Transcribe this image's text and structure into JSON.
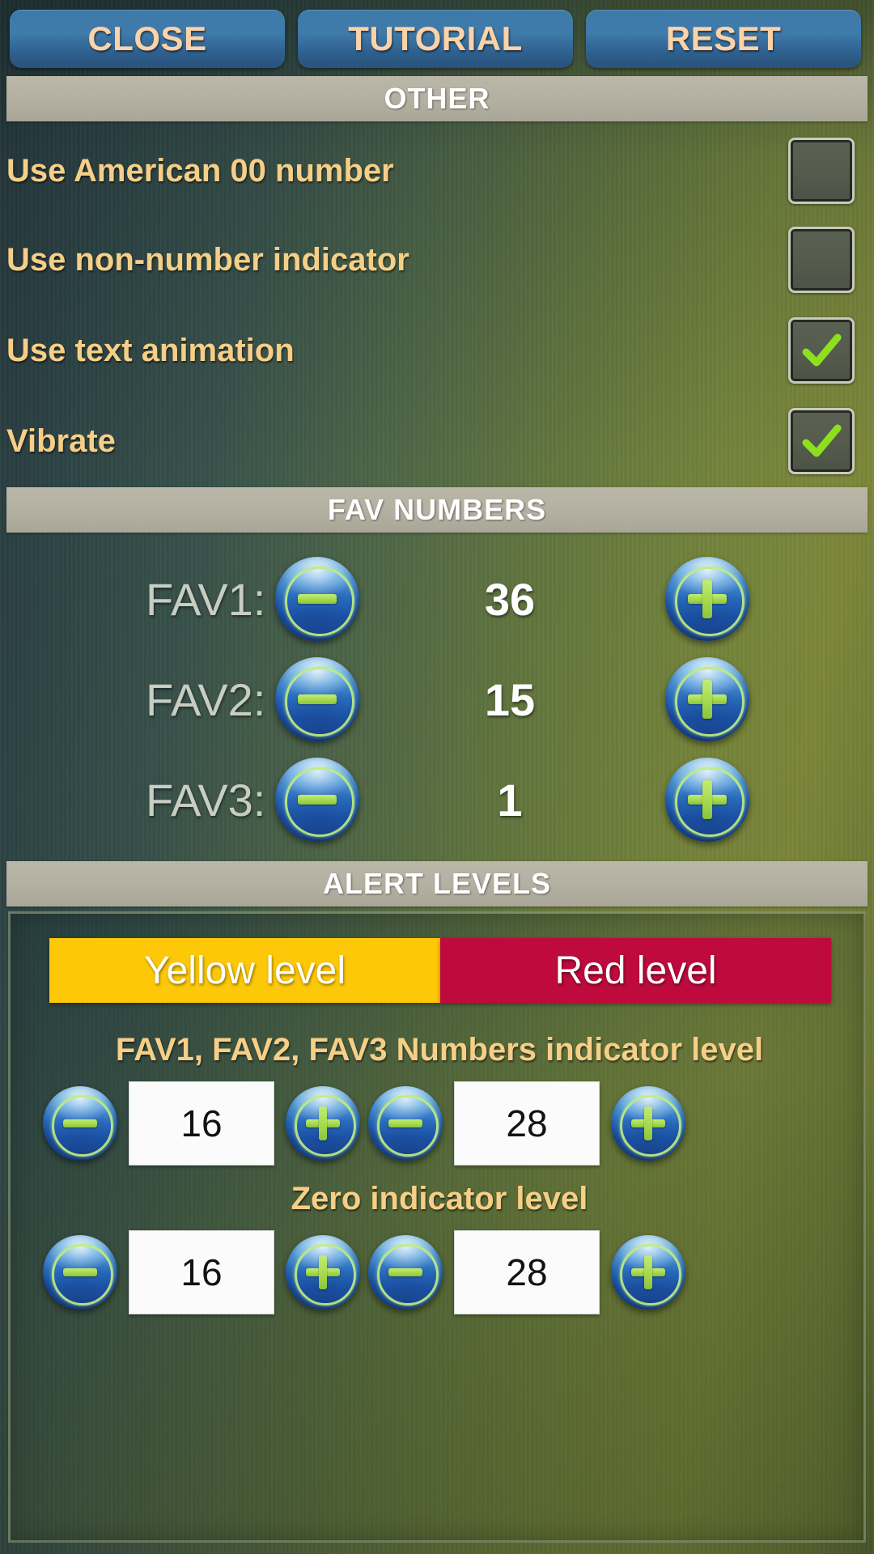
{
  "toolbar": {
    "close_label": "CLOSE",
    "tutorial_label": "TUTORIAL",
    "reset_label": "RESET"
  },
  "sections": {
    "other_title": "OTHER",
    "fav_title": "FAV NUMBERS",
    "alert_title": "ALERT LEVELS"
  },
  "other_options": [
    {
      "label": "Use American 00 number",
      "checked": false
    },
    {
      "label": "Use non-number indicator",
      "checked": false
    },
    {
      "label": "Use text animation",
      "checked": true
    },
    {
      "label": "Vibrate",
      "checked": true
    }
  ],
  "fav_numbers": [
    {
      "label": "FAV1:",
      "value": "36"
    },
    {
      "label": "FAV2:",
      "value": "15"
    },
    {
      "label": "FAV3:",
      "value": "1"
    }
  ],
  "alert_levels": {
    "yellow_tab": "Yellow level",
    "red_tab": "Red level",
    "fav_indicator_label": "FAV1, FAV2, FAV3 Numbers indicator level",
    "zero_indicator_label": "Zero indicator level",
    "fav_yellow_value": "16",
    "fav_red_value": "28",
    "zero_yellow_value": "16",
    "zero_red_value": "28"
  },
  "icons": {
    "minus": "minus-icon",
    "plus": "plus-icon",
    "check": "check-icon"
  },
  "colors": {
    "button_blue": "#3d7aa8",
    "button_text": "#fcd2a8",
    "label_gold": "#f6cf87",
    "section_bar": "#b3b0a1",
    "yellow_level": "#fdc807",
    "red_level": "#be0a3c",
    "check_green": "#8ee01e",
    "orb_blue": "#2d72c4",
    "orb_glyph_green": "#a6d94e"
  }
}
